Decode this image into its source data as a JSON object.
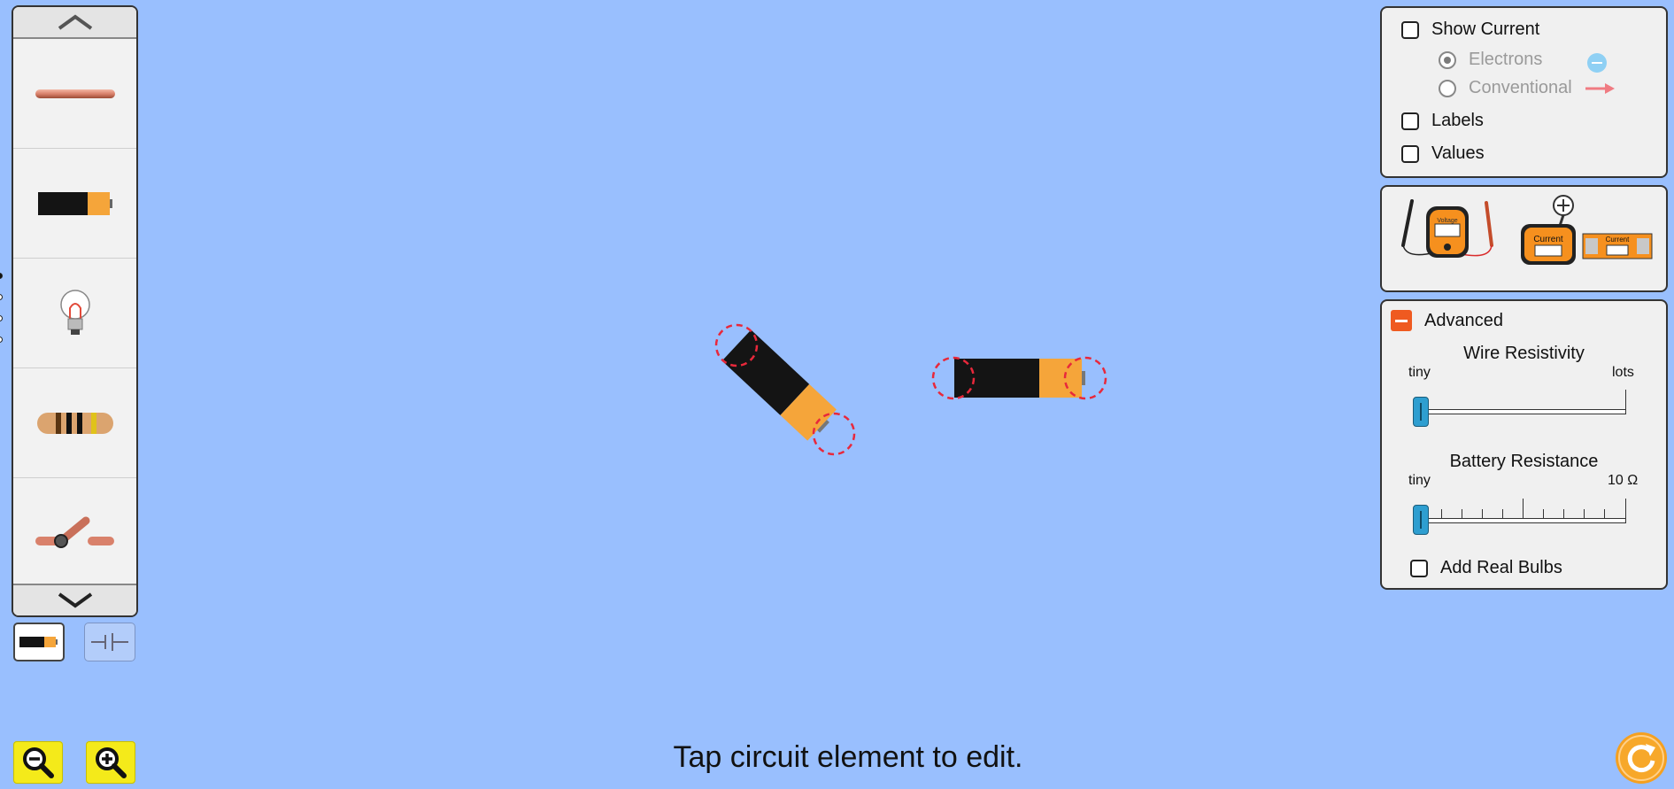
{
  "status": {
    "message": "Tap circuit element to edit."
  },
  "carousel": {
    "items": [
      {
        "id": "wire",
        "icon": "wire-icon"
      },
      {
        "id": "battery",
        "icon": "battery-icon"
      },
      {
        "id": "light-bulb",
        "icon": "light-bulb-icon"
      },
      {
        "id": "resistor",
        "icon": "resistor-icon"
      },
      {
        "id": "switch",
        "icon": "switch-icon"
      }
    ],
    "pages": 4,
    "active_page": 1
  },
  "view_type": {
    "selected": "lifelike",
    "options": [
      "lifelike",
      "schematic"
    ]
  },
  "display_panel": {
    "show_current": {
      "label": "Show Current",
      "checked": false
    },
    "electrons": {
      "label": "Electrons",
      "selected": true
    },
    "conventional": {
      "label": "Conventional",
      "selected": false
    },
    "labels": {
      "label": "Labels",
      "checked": false
    },
    "values": {
      "label": "Values",
      "checked": false
    }
  },
  "meters": {
    "voltmeter_label": "Voltage",
    "ammeter_label": "Current",
    "noncontact_ammeter_label": "Current"
  },
  "advanced": {
    "title": "Advanced",
    "expanded": true,
    "wire_resistivity": {
      "title": "Wire Resistivity",
      "min_label": "tiny",
      "max_label": "lots",
      "value": 0
    },
    "battery_resistance": {
      "title": "Battery Resistance",
      "min_label": "tiny",
      "max_label": "10 Ω",
      "value": 0
    },
    "real_bulbs": {
      "label": "Add Real Bulbs",
      "checked": false
    }
  },
  "colors": {
    "background": "#99bffe",
    "battery_body": "#111111",
    "battery_tip": "#f5a53a",
    "accent": "#ef5a20"
  }
}
